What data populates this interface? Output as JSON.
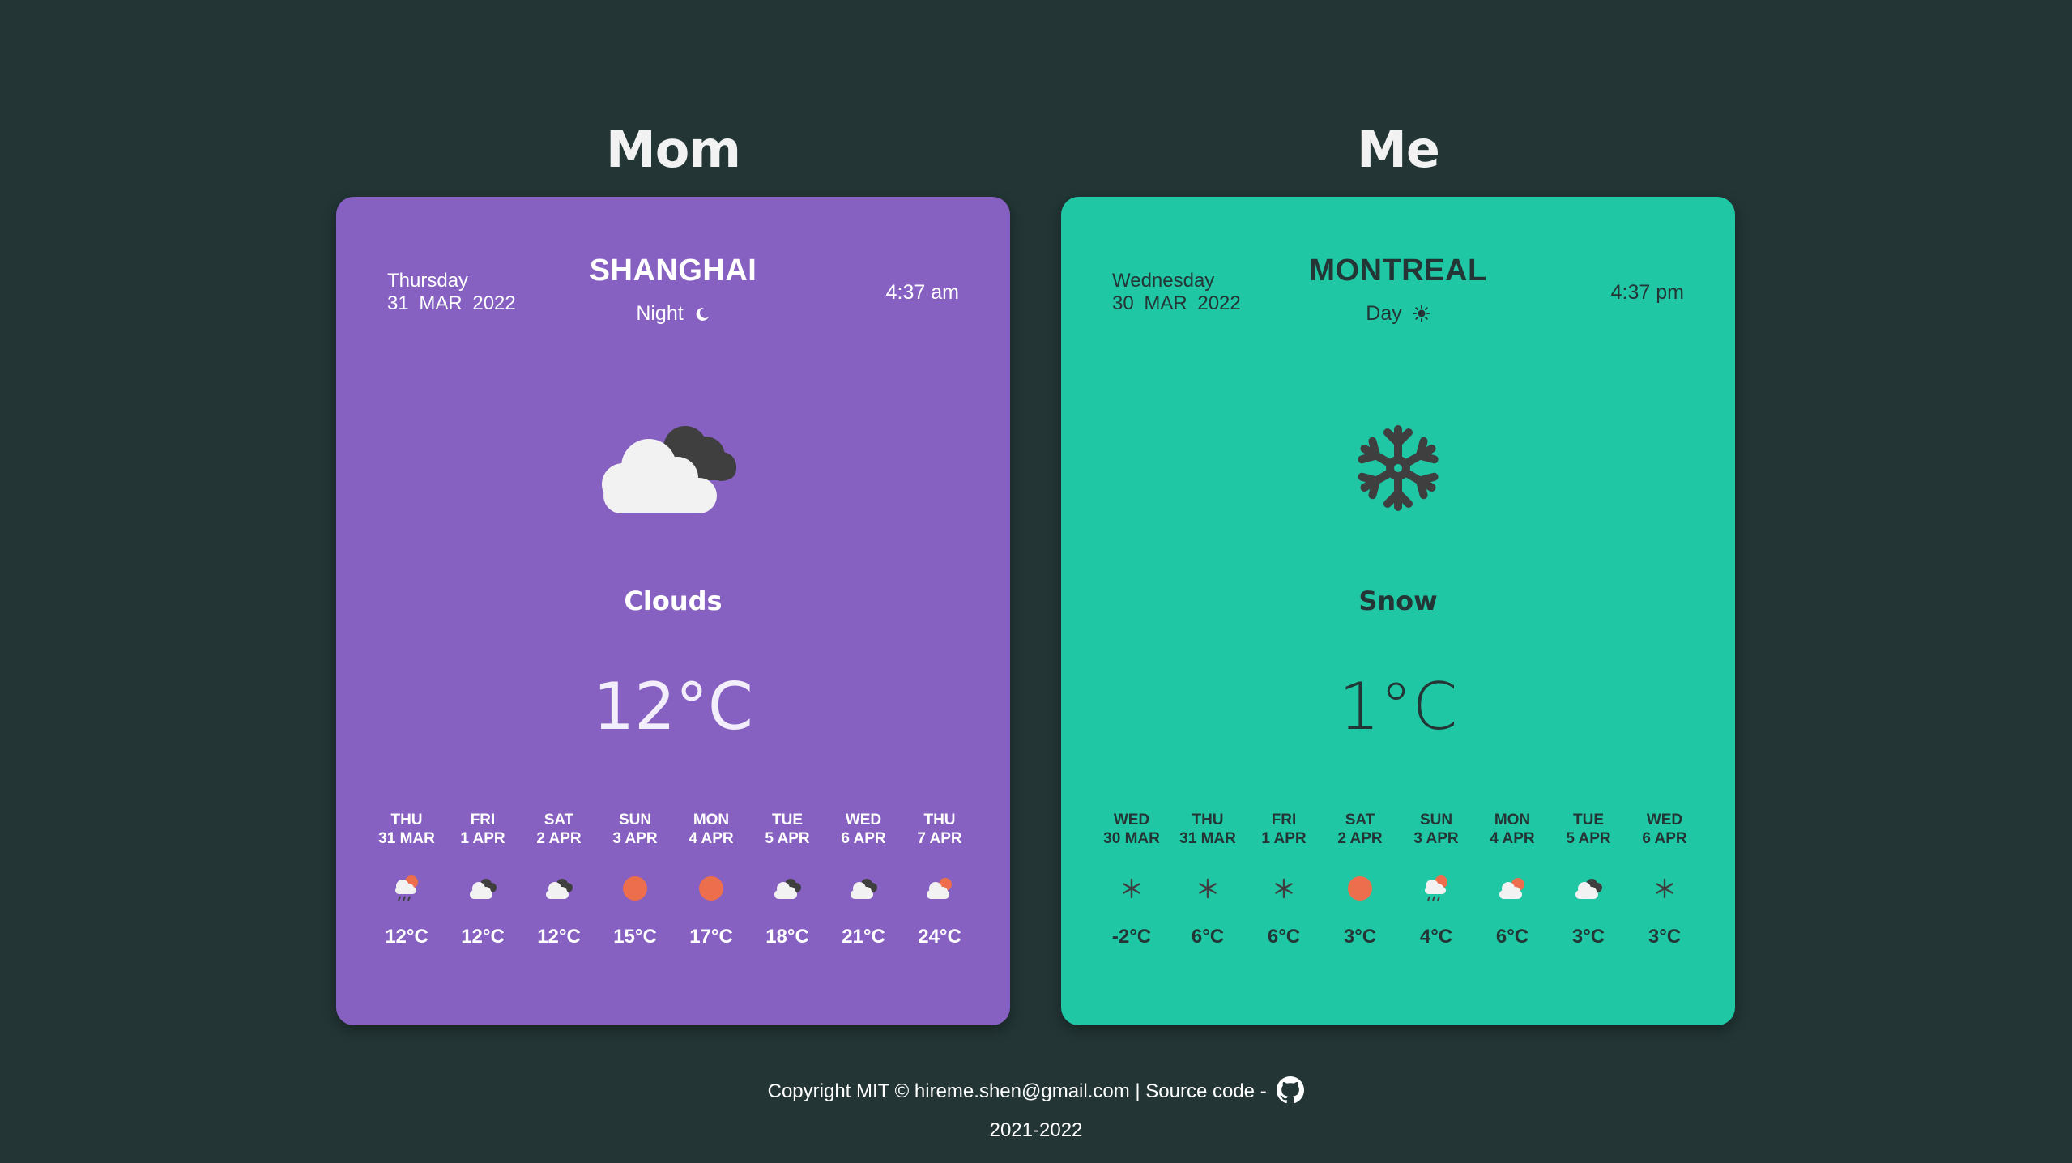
{
  "cards": [
    {
      "person": "Mom",
      "day_name": "Thursday",
      "date": "31 MAR 2022",
      "city": "SHANGHAI",
      "period": "Night",
      "period_icon": "moon-icon",
      "time": "4:37 am",
      "main_icon": "clouds-icon",
      "condition": "Clouds",
      "temperature": "12°C",
      "accent": "#8661c1",
      "forecast": [
        {
          "dow": "THU",
          "date": "31 MAR",
          "icon": "rain-sun-icon",
          "temp": "12°C"
        },
        {
          "dow": "FRI",
          "date": "1 APR",
          "icon": "clouds-icon",
          "temp": "12°C"
        },
        {
          "dow": "SAT",
          "date": "2 APR",
          "icon": "clouds-icon",
          "temp": "12°C"
        },
        {
          "dow": "SUN",
          "date": "3 APR",
          "icon": "sun-icon",
          "temp": "15°C"
        },
        {
          "dow": "MON",
          "date": "4 APR",
          "icon": "sun-icon",
          "temp": "17°C"
        },
        {
          "dow": "TUE",
          "date": "5 APR",
          "icon": "clouds-icon",
          "temp": "18°C"
        },
        {
          "dow": "WED",
          "date": "6 APR",
          "icon": "clouds-icon",
          "temp": "21°C"
        },
        {
          "dow": "THU",
          "date": "7 APR",
          "icon": "cloud-sun-icon",
          "temp": "24°C"
        }
      ]
    },
    {
      "person": "Me",
      "day_name": "Wednesday",
      "date": "30 MAR 2022",
      "city": "MONTREAL",
      "period": "Day",
      "period_icon": "sun-icon",
      "time": "4:37 pm",
      "main_icon": "snowflake-icon",
      "condition": "Snow",
      "temperature": "1°C",
      "accent": "#20c7a5",
      "forecast": [
        {
          "dow": "WED",
          "date": "30 MAR",
          "icon": "snowflake-icon",
          "temp": "-2°C"
        },
        {
          "dow": "THU",
          "date": "31 MAR",
          "icon": "snowflake-icon",
          "temp": "6°C"
        },
        {
          "dow": "FRI",
          "date": "1 APR",
          "icon": "snowflake-icon",
          "temp": "6°C"
        },
        {
          "dow": "SAT",
          "date": "2 APR",
          "icon": "sun-icon",
          "temp": "3°C"
        },
        {
          "dow": "SUN",
          "date": "3 APR",
          "icon": "rain-sun-icon",
          "temp": "4°C"
        },
        {
          "dow": "MON",
          "date": "4 APR",
          "icon": "cloud-sun-icon",
          "temp": "6°C"
        },
        {
          "dow": "TUE",
          "date": "5 APR",
          "icon": "clouds-icon",
          "temp": "3°C"
        },
        {
          "dow": "WED",
          "date": "6 APR",
          "icon": "snowflake-icon",
          "temp": "3°C"
        }
      ]
    }
  ],
  "footer": {
    "copyright": "Copyright MIT © hireme.shen@gmail.com  |  Source code -",
    "source_icon": "github-icon",
    "years": "2021-2022"
  },
  "colors": {
    "background": "#233535",
    "sun": "#ec6e4c",
    "cloud_light": "#f2f2f2",
    "cloud_dark": "#3f3f3f"
  }
}
